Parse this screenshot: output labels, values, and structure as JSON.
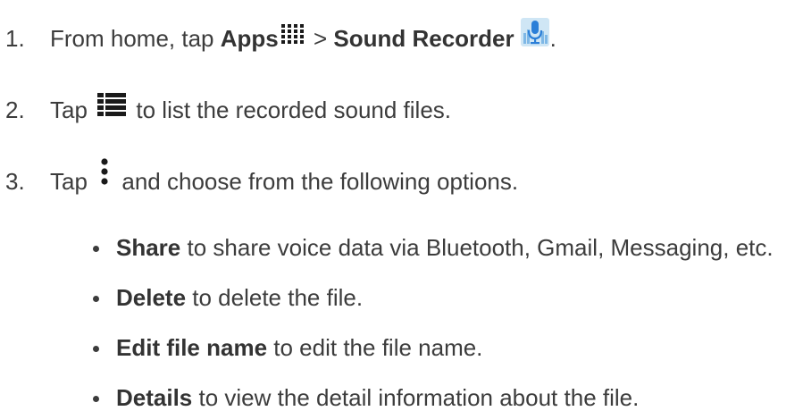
{
  "steps": [
    {
      "number": "1.",
      "text_a": "From home, tap ",
      "bold_a": "Apps",
      "text_b": " > ",
      "bold_b": "Sound Recorder",
      "text_c": ".",
      "icon_a": "apps-grid-icon",
      "icon_b": "sound-recorder-icon"
    },
    {
      "number": "2.",
      "text_a": "Tap ",
      "text_b": " to list the recorded sound files.",
      "icon": "list-icon"
    },
    {
      "number": "3.",
      "text_a": "Tap ",
      "text_b": " and choose from the following options.",
      "icon": "more-options-icon"
    }
  ],
  "options": [
    {
      "bold": "Share",
      "text": " to share voice data via Bluetooth, Gmail, Messaging, etc."
    },
    {
      "bold": "Delete",
      "text": " to delete the file."
    },
    {
      "bold": "Edit file name",
      "text": " to edit the file name."
    },
    {
      "bold": "Details",
      "text": " to view the detail information about the file."
    }
  ],
  "colors": {
    "text": "#3c3c3c",
    "icon_dark": "#1a1a1a",
    "mic_blue": "#2b7fd8",
    "mic_bg": "#cfe6f5"
  }
}
